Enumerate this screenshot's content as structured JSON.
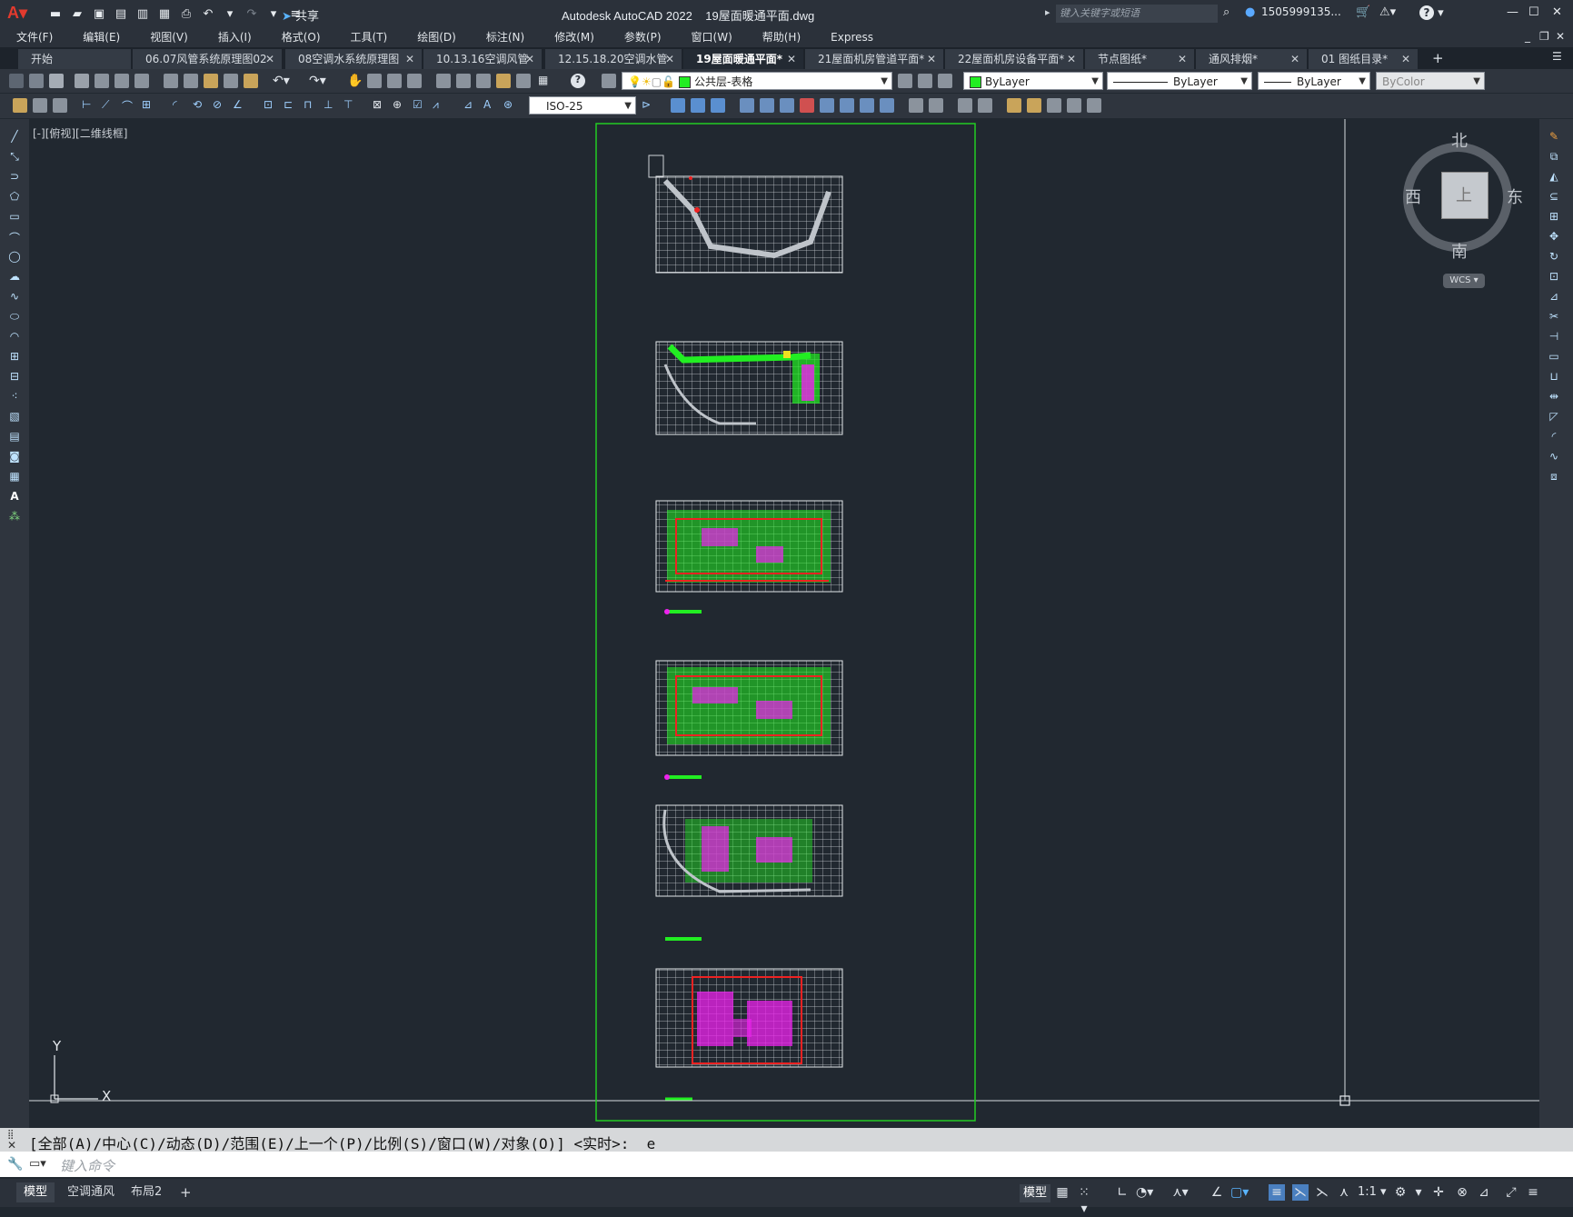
{
  "titlebar": {
    "app_title": "Autodesk AutoCAD 2022",
    "file_name": "19屋面暖通平面.dwg",
    "share_label": "共享",
    "search_placeholder": "键入关键字或短语",
    "user_name": "1505999135...",
    "help_label": "?"
  },
  "menu": [
    "文件(F)",
    "编辑(E)",
    "视图(V)",
    "插入(I)",
    "格式(O)",
    "工具(T)",
    "绘图(D)",
    "标注(N)",
    "修改(M)",
    "参数(P)",
    "窗口(W)",
    "帮助(H)",
    "Express"
  ],
  "tabs": [
    {
      "label": "开始",
      "closable": false
    },
    {
      "label": "06.07风管系统原理图02",
      "closable": true
    },
    {
      "label": "08空调水系统原理图",
      "closable": true
    },
    {
      "label": "10.13.16空调风管",
      "closable": true
    },
    {
      "label": "12.15.18.20空调水管",
      "closable": true
    },
    {
      "label": "19屋面暖通平面*",
      "closable": true,
      "active": true
    },
    {
      "label": "21屋面机房管道平面*",
      "closable": true
    },
    {
      "label": "22屋面机房设备平面*",
      "closable": true
    },
    {
      "label": "节点图纸*",
      "closable": true
    },
    {
      "label": "通风排烟*",
      "closable": true
    },
    {
      "label": "01 图纸目录*",
      "closable": true
    }
  ],
  "properties": {
    "layer": "公共层-表格",
    "color": "ByLayer",
    "linetype": "ByLayer",
    "lineweight": "ByLayer",
    "plotstyle": "ByColor",
    "dimstyle": "ISO-25"
  },
  "viewport": {
    "label": "[-][俯视][二维线框]"
  },
  "viewcube": {
    "north": "北",
    "south": "南",
    "east": "东",
    "west": "西",
    "face": "上",
    "wcs": "WCS"
  },
  "ucs": {
    "x": "X",
    "y": "Y"
  },
  "command": {
    "history": "[全部(A)/中心(C)/动态(D)/范围(E)/上一个(P)/比例(S)/窗口(W)/对象(O)] <实时>: _e",
    "placeholder": "键入命令"
  },
  "status": {
    "layout_tabs": [
      "模型",
      "空调通风",
      "布局2"
    ],
    "model_label": "模型",
    "scale": "1:1"
  },
  "colors": {
    "accent": "#e33a2e",
    "drawing_frame": "#22cc22",
    "green": "#22ee22",
    "magenta": "#ee22ee",
    "red": "#ee2222"
  }
}
